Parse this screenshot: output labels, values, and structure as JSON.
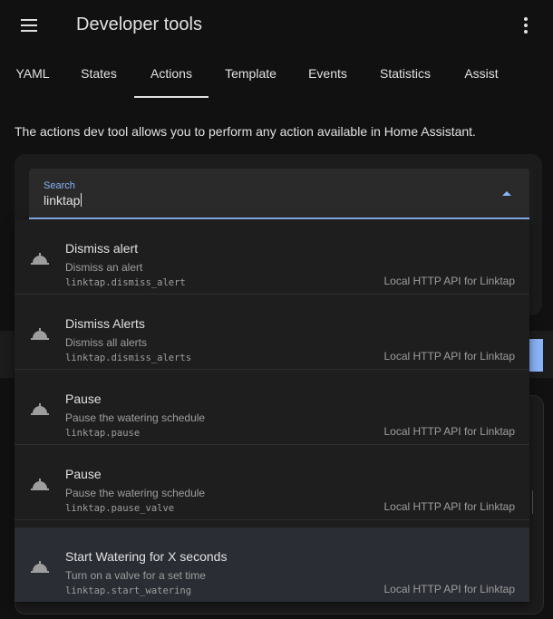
{
  "header": {
    "title": "Developer tools"
  },
  "tabs": [
    {
      "label": "YAML"
    },
    {
      "label": "States"
    },
    {
      "label": "Actions",
      "active": true
    },
    {
      "label": "Template"
    },
    {
      "label": "Events"
    },
    {
      "label": "Statistics"
    },
    {
      "label": "Assist"
    }
  ],
  "description": "The actions dev tool allows you to perform any action available in Home Assistant.",
  "search": {
    "label": "Search",
    "value": "linktap"
  },
  "results": [
    {
      "name": "Dismiss alert",
      "desc": "Dismiss an alert",
      "id": "linktap.dismiss_alert",
      "integration": "Local HTTP API for Linktap",
      "icon": "bell-service-icon"
    },
    {
      "name": "Dismiss Alerts",
      "desc": "Dismiss all alerts",
      "id": "linktap.dismiss_alerts",
      "integration": "Local HTTP API for Linktap",
      "icon": "bell-service-icon"
    },
    {
      "name": "Pause",
      "desc": "Pause the watering schedule",
      "id": "linktap.pause",
      "integration": "Local HTTP API for Linktap",
      "icon": "bell-service-icon"
    },
    {
      "name": "Pause",
      "desc": "Pause the watering schedule",
      "id": "linktap.pause_valve",
      "integration": "Local HTTP API for Linktap",
      "icon": "bell-service-icon"
    },
    {
      "name": "Start Watering for X seconds",
      "desc": "Turn on a valve for a set time",
      "id": "linktap.start_watering",
      "integration": "Local HTTP API for Linktap",
      "icon": "bell-service-icon",
      "highlighted": true
    }
  ],
  "colors": {
    "background": "#111111",
    "card": "#1c1c1c",
    "accent": "#8ab4f8",
    "text": "#e1e1e1",
    "secondary": "#9e9e9e",
    "highlight": "#2a2d33"
  }
}
